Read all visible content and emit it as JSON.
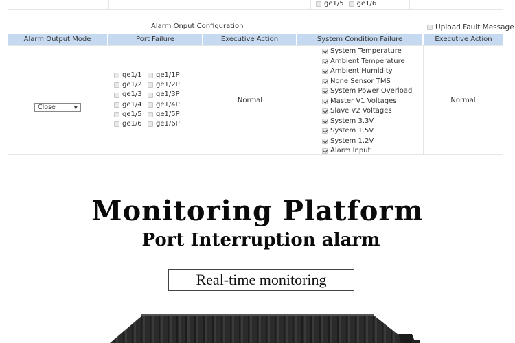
{
  "top_table": {
    "ports": [
      {
        "label": "ge1/5",
        "checked": false
      },
      {
        "label": "ge1/6",
        "checked": false
      }
    ]
  },
  "alarm_config": {
    "title": "Alarm Onput Configuration",
    "upload_fault_message": {
      "label": "Upload Fault Message",
      "checked": false
    },
    "headers": {
      "alarm_output_mode": "Alarm Output Mode",
      "port_failure": "Port Failure",
      "executive_action_1": "Executive Action",
      "system_condition_failure": "System Condition Failure",
      "executive_action_2": "Executive Action"
    },
    "alarm_output_mode": {
      "selected": "Close",
      "arrow": "▼"
    },
    "port_failure": [
      [
        {
          "label": "ge1/1",
          "checked": false
        },
        {
          "label": "ge1/1P",
          "checked": false
        }
      ],
      [
        {
          "label": "ge1/2",
          "checked": false
        },
        {
          "label": "ge1/2P",
          "checked": false
        }
      ],
      [
        {
          "label": "ge1/3",
          "checked": false
        },
        {
          "label": "ge1/3P",
          "checked": false
        }
      ],
      [
        {
          "label": "ge1/4",
          "checked": false
        },
        {
          "label": "ge1/4P",
          "checked": false
        }
      ],
      [
        {
          "label": "ge1/5",
          "checked": false
        },
        {
          "label": "ge1/5P",
          "checked": false
        }
      ],
      [
        {
          "label": "ge1/6",
          "checked": false
        },
        {
          "label": "ge1/6P",
          "checked": false
        }
      ]
    ],
    "executive_action_1": "Normal",
    "system_conditions": [
      {
        "label": "System Temperature",
        "checked": true
      },
      {
        "label": "Ambient Temperature",
        "checked": true
      },
      {
        "label": "Ambient Humidity",
        "checked": true
      },
      {
        "label": "None Sensor TMS",
        "checked": true
      },
      {
        "label": "System Power Overload",
        "checked": true
      },
      {
        "label": "Master V1 Voltages",
        "checked": true
      },
      {
        "label": "Slave V2 Voltages",
        "checked": true
      },
      {
        "label": "System 3.3V",
        "checked": true
      },
      {
        "label": "System 1.5V",
        "checked": true
      },
      {
        "label": "System 1.2V",
        "checked": true
      },
      {
        "label": "Alarm Input",
        "checked": true
      }
    ],
    "executive_action_2": "Normal"
  },
  "promo": {
    "title": "Monitoring Platform",
    "subtitle": "Port Interruption alarm",
    "boxed_label": "Real-time monitoring"
  },
  "colors": {
    "header_bg": "#c5d9f1",
    "device": "#2b2b2b"
  }
}
